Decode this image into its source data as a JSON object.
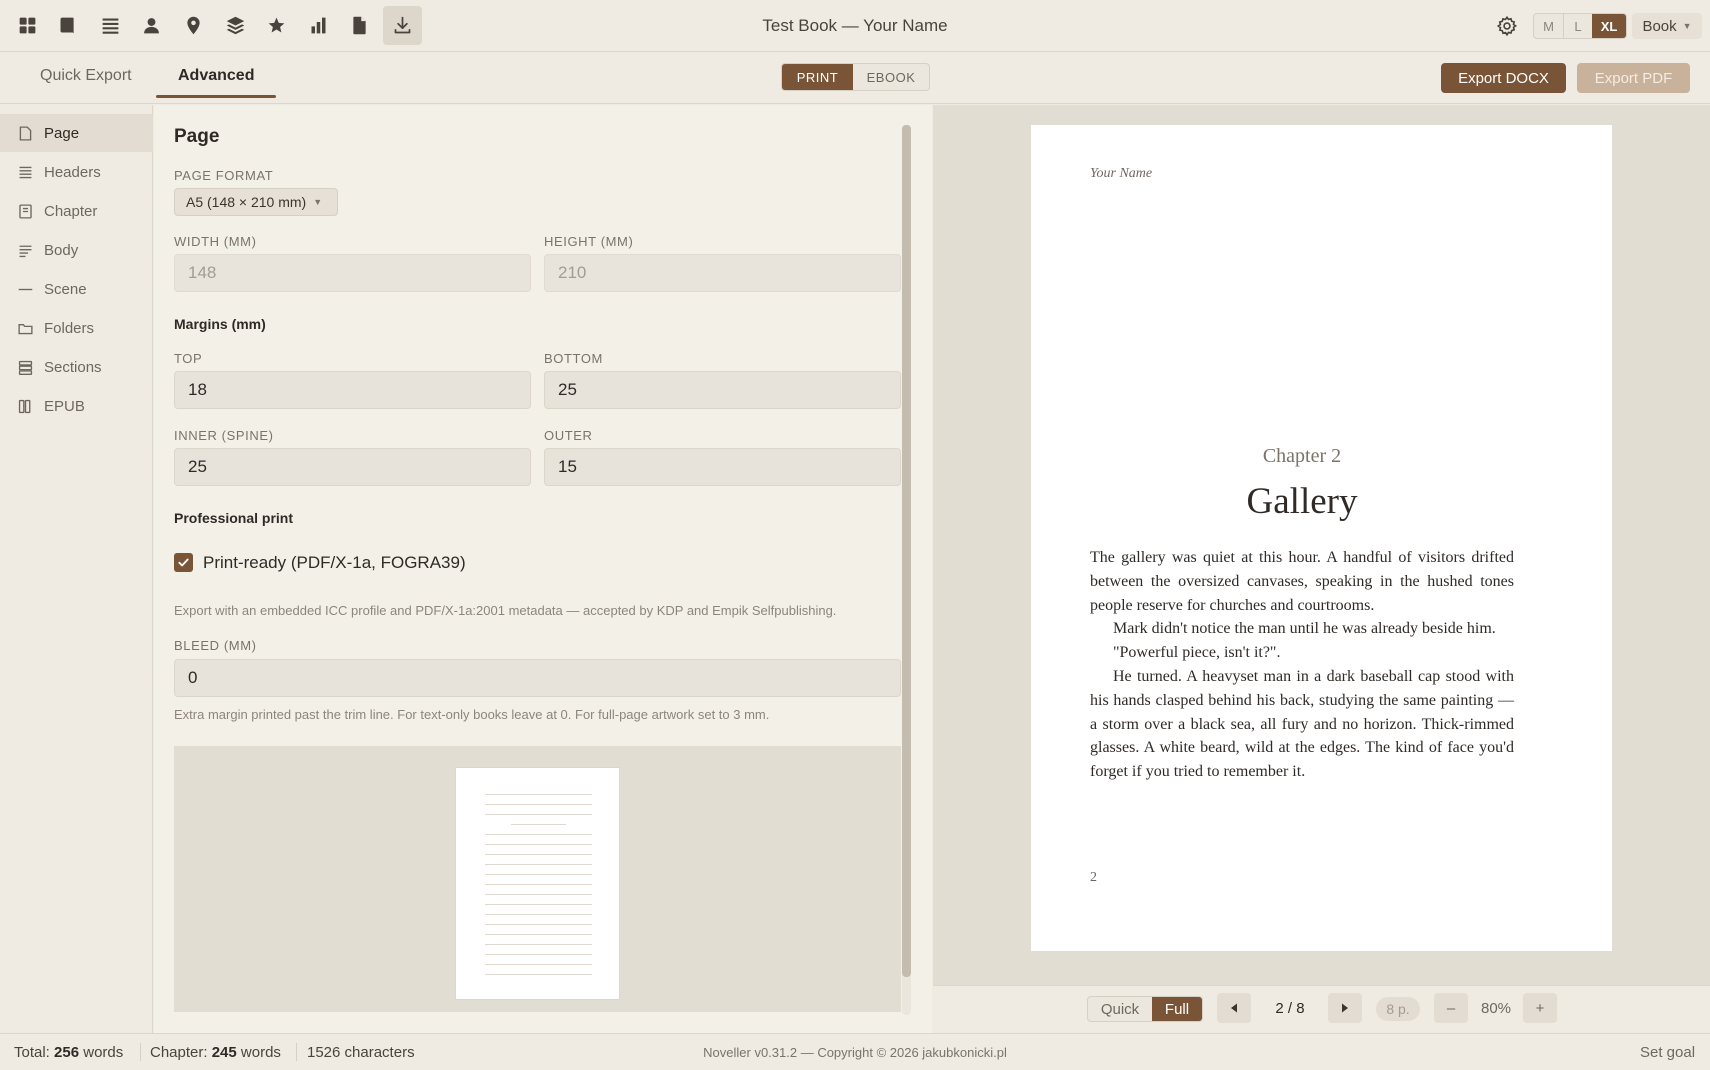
{
  "app": {
    "title": "Test Book — Your Name"
  },
  "toolbar": {
    "sizes": [
      "M",
      "L",
      "XL"
    ],
    "active_size": "XL",
    "book_menu": "Book"
  },
  "tabs": [
    "Quick Export",
    "Advanced"
  ],
  "mode": {
    "print": "PRINT",
    "ebook": "EBOOK",
    "active": "PRINT"
  },
  "actions": {
    "export_docx": "Export DOCX",
    "export_pdf": "Export PDF"
  },
  "sidebar": {
    "items": [
      {
        "label": "Page"
      },
      {
        "label": "Headers"
      },
      {
        "label": "Chapter"
      },
      {
        "label": "Body"
      },
      {
        "label": "Scene"
      },
      {
        "label": "Folders"
      },
      {
        "label": "Sections"
      },
      {
        "label": "EPUB"
      }
    ]
  },
  "page_settings": {
    "title": "Page",
    "format_label": "PAGE FORMAT",
    "format_value": "A5 (148 × 210 mm)",
    "width_label": "WIDTH (MM)",
    "width_value": "148",
    "height_label": "HEIGHT (MM)",
    "height_value": "210",
    "margins_title": "Margins (mm)",
    "top_label": "TOP",
    "top_value": "18",
    "bottom_label": "BOTTOM",
    "bottom_value": "25",
    "inner_label": "INNER (SPINE)",
    "inner_value": "25",
    "outer_label": "OUTER",
    "outer_value": "15",
    "pro_title": "Professional print",
    "print_ready_label": "Print-ready (PDF/X-1a, FOGRA39)",
    "print_ready_checked": true,
    "print_ready_help": "Export with an embedded ICC profile and PDF/X-1a:2001 metadata — accepted by KDP and Empik Selfpublishing.",
    "bleed_label": "BLEED (MM)",
    "bleed_value": "0",
    "bleed_help": "Extra margin printed past the trim line. For text-only books leave at 0. For full-page artwork set to 3 mm."
  },
  "preview": {
    "running_head": "Your Name",
    "chapter_label": "Chapter 2",
    "chapter_title": "Gallery",
    "paragraphs": [
      "The gallery was quiet at this hour. A handful of visitors drifted between the oversized canvases, speaking in the hushed tones people reserve for churches and courtrooms.",
      "Mark didn't notice the man until he was already beside him.",
      "\"Powerful piece, isn't it?\".",
      "He turned. A heavyset man in a dark baseball cap stood with his hands clasped behind his back, studying the same painting — a storm over a black sea, all fury and no horizon. Thick-rimmed glasses. A white beard, wild at the edges. The kind of face you'd forget if you tried to remember it."
    ],
    "folio": "2"
  },
  "preview_controls": {
    "quick": "Quick",
    "full": "Full",
    "active": "Full",
    "page_indicator": "2 / 8",
    "pages_badge": "8 p.",
    "zoom_out": "–",
    "zoom_value": "80%",
    "zoom_in": "+"
  },
  "status": {
    "total_label": "Total:",
    "total_count": "256",
    "total_unit": "words",
    "chapter_label": "Chapter:",
    "chapter_count": "245",
    "chapter_unit": "words",
    "characters": "1526 characters",
    "copyright": "Noveller v0.31.2 — Copyright © 2026 jakubkonicki.pl",
    "set_goal": "Set goal"
  }
}
